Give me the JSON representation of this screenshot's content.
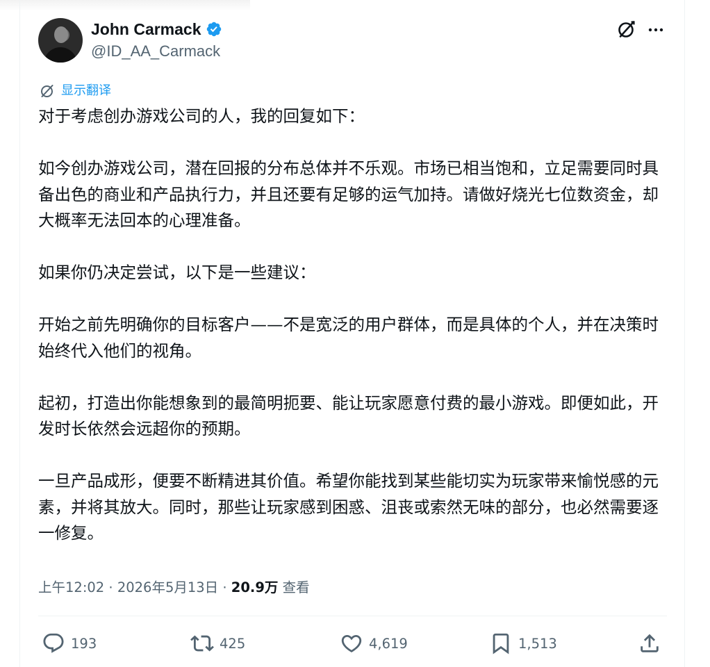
{
  "author": {
    "display_name": "John Carmack",
    "handle": "@ID_AA_Carmack",
    "verified": true,
    "verified_color": "#1d9bf0"
  },
  "translate_label": "显示翻译",
  "tweet": {
    "paragraphs": [
      "对于考虑创办游戏公司的人，我的回复如下：",
      "如今创办游戏公司，潜在回报的分布总体并不乐观。市场已相当饱和，立足需要同时具备出色的商业和产品执行力，并且还要有足够的运气加持。请做好烧光七位数资金，却大概率无法回本的心理准备。",
      "如果你仍决定尝试，以下是一些建议：",
      "开始之前先明确你的目标客户——不是宽泛的用户群体，而是具体的个人，并在决策时始终代入他们的视角。",
      "起初，打造出你能想象到的最简明扼要、能让玩家愿意付费的最小游戏。即便如此，开发时长依然会远超你的预期。",
      "一旦产品成形，便要不断精进其价值。希望你能找到某些能切实为玩家带来愉悦感的元素，并将其放大。同时，那些让玩家感到困惑、沮丧或索然无味的部分，也必然需要逐一修复。"
    ]
  },
  "meta": {
    "time": "上午12:02",
    "separator": " · ",
    "date": "2026年5月13日",
    "views_count": "20.9万",
    "views_label": " 查看"
  },
  "actions": {
    "replies": "193",
    "reposts": "425",
    "likes": "4,619",
    "bookmarks": "1,513"
  },
  "icons": {
    "grok": "grok-icon",
    "more": "more-icon",
    "translate": "translate-icon",
    "reply": "reply-icon",
    "repost": "repost-icon",
    "like": "heart-icon",
    "bookmark": "bookmark-icon",
    "share": "share-icon"
  },
  "colors": {
    "text": "#0f1419",
    "secondary": "#536471",
    "link": "#1d9bf0",
    "divider": "#eff3f4"
  }
}
